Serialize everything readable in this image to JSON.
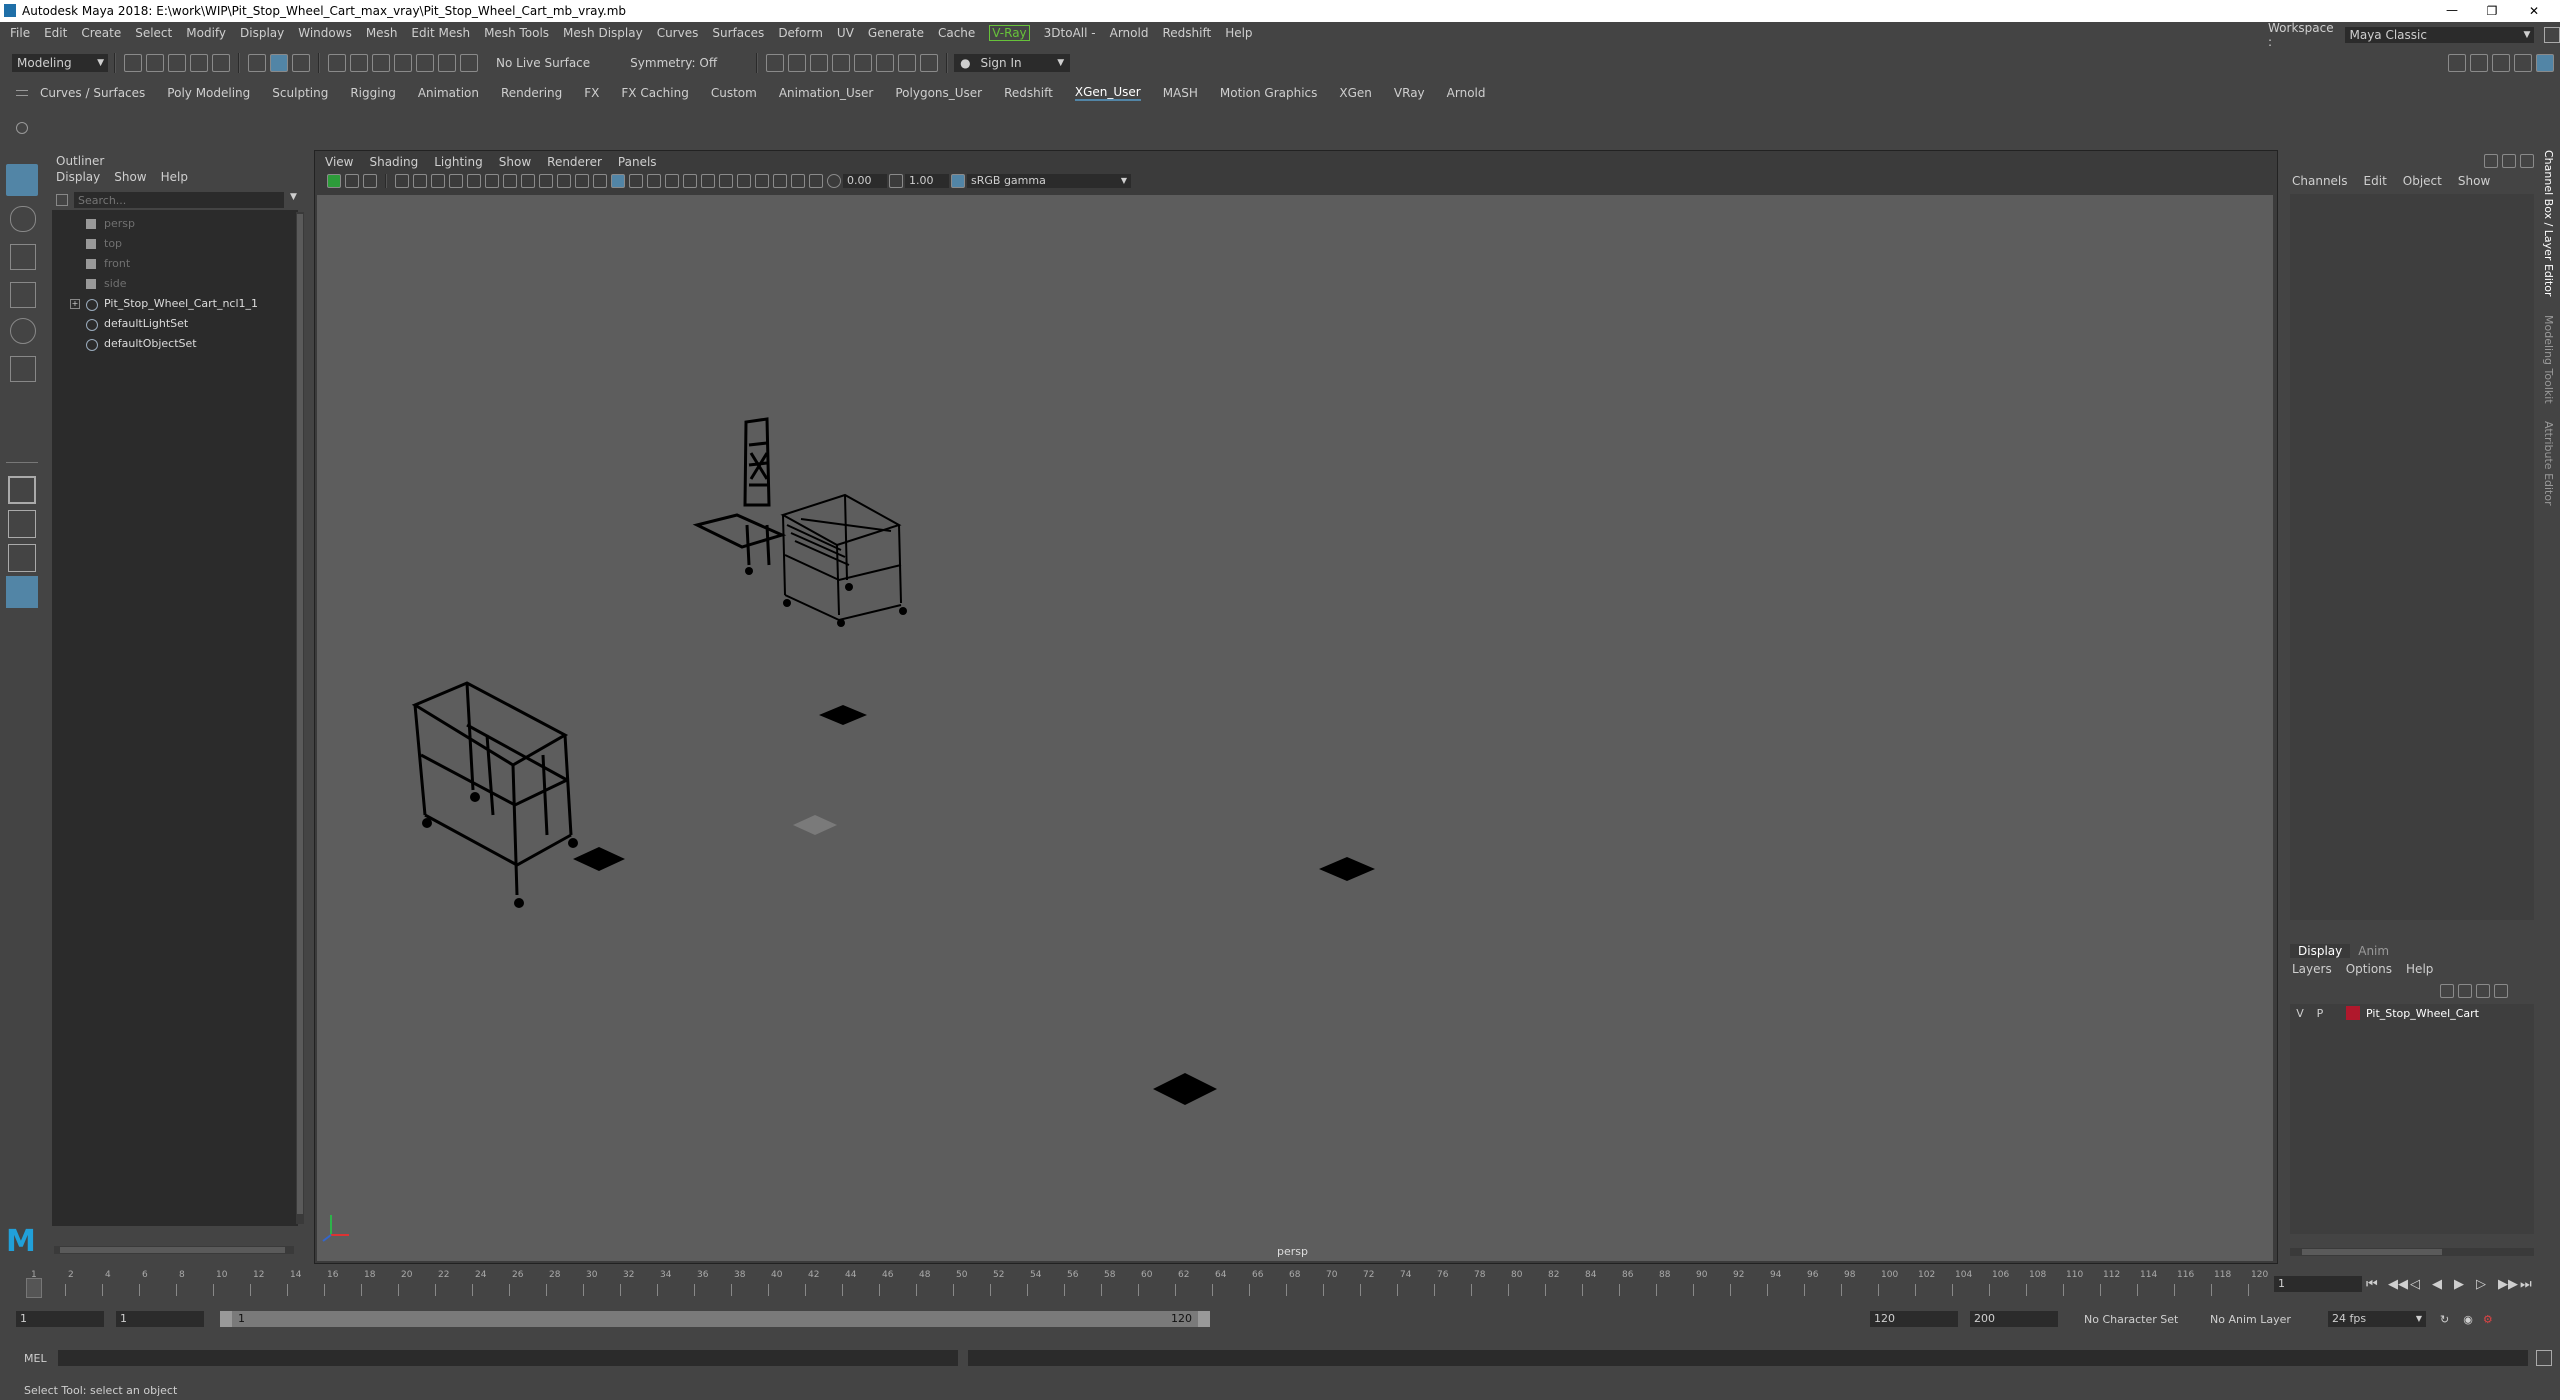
{
  "window": {
    "title": "Autodesk Maya 2018: E:\\work\\WIP\\Pit_Stop_Wheel_Cart_max_vray\\Pit_Stop_Wheel_Cart_mb_vray.mb",
    "workspace_label": "Workspace :",
    "workspace_value": "Maya Classic"
  },
  "menubar": [
    "File",
    "Edit",
    "Create",
    "Select",
    "Modify",
    "Display",
    "Windows",
    "Mesh",
    "Edit Mesh",
    "Mesh Tools",
    "Mesh Display",
    "Curves",
    "Surfaces",
    "Deform",
    "UV",
    "Generate",
    "Cache",
    "V-Ray",
    "3DtoAll -",
    "Arnold",
    "Redshift",
    "Help"
  ],
  "status_line": {
    "mode": "Modeling",
    "live_surface": "No Live Surface",
    "symmetry": "Symmetry: Off",
    "sign_in": "Sign In"
  },
  "shelf_tabs": [
    "Curves / Surfaces",
    "Poly Modeling",
    "Sculpting",
    "Rigging",
    "Animation",
    "Rendering",
    "FX",
    "FX Caching",
    "Custom",
    "Animation_User",
    "Polygons_User",
    "Redshift",
    "XGen_User",
    "MASH",
    "Motion Graphics",
    "XGen",
    "VRay",
    "Arnold"
  ],
  "shelf_active": "XGen_User",
  "outliner": {
    "title": "Outliner",
    "menu": [
      "Display",
      "Show",
      "Help"
    ],
    "search_placeholder": "Search...",
    "items": [
      {
        "label": "persp",
        "dim": true
      },
      {
        "label": "top",
        "dim": true
      },
      {
        "label": "front",
        "dim": true
      },
      {
        "label": "side",
        "dim": true
      },
      {
        "label": "Pit_Stop_Wheel_Cart_ncl1_1",
        "dim": false
      },
      {
        "label": "defaultLightSet",
        "dim": false
      },
      {
        "label": "defaultObjectSet",
        "dim": false
      }
    ]
  },
  "viewport": {
    "menu": [
      "View",
      "Shading",
      "Lighting",
      "Show",
      "Renderer",
      "Panels"
    ],
    "exposure": "0.00",
    "gamma": "1.00",
    "color_space": "sRGB gamma",
    "camera_label": "persp"
  },
  "channel_box": {
    "menu": [
      "Channels",
      "Edit",
      "Object",
      "Show"
    ],
    "side_tabs": [
      "Channel Box / Layer Editor",
      "Modeling Toolkit",
      "Attribute Editor"
    ]
  },
  "layer_editor": {
    "tabs": [
      "Display",
      "Anim"
    ],
    "menu": [
      "Layers",
      "Options",
      "Help"
    ],
    "layer": {
      "v": "V",
      "p": "P",
      "name": "Pit_Stop_Wheel_Cart",
      "color": "#b0182c"
    }
  },
  "timeline": {
    "ticks": [
      "1",
      "2",
      "4",
      "6",
      "8",
      "10",
      "12",
      "14",
      "16",
      "18",
      "20",
      "22",
      "24",
      "26",
      "28",
      "30",
      "32",
      "34",
      "36",
      "38",
      "40",
      "42",
      "44",
      "46",
      "48",
      "50",
      "52",
      "54",
      "56",
      "58",
      "60",
      "62",
      "64",
      "66",
      "68",
      "70",
      "72",
      "74",
      "76",
      "78",
      "80",
      "82",
      "84",
      "86",
      "88",
      "90",
      "92",
      "94",
      "96",
      "98",
      "100",
      "102",
      "104",
      "106",
      "108",
      "110",
      "112",
      "114",
      "116",
      "118",
      "120"
    ],
    "current_frame": "1"
  },
  "range": {
    "start": "1",
    "anim_start": "1",
    "slider_start": "1",
    "slider_end": "120",
    "end": "120",
    "anim_end": "200",
    "character_set": "No Character Set",
    "anim_layer": "No Anim Layer",
    "fps": "24 fps"
  },
  "command_line": {
    "label": "MEL"
  },
  "help_line": "Select Tool: select an object",
  "colors": {
    "active_tab": "#5285a6",
    "vray": "#67c23a",
    "layer": "#b0182c"
  }
}
